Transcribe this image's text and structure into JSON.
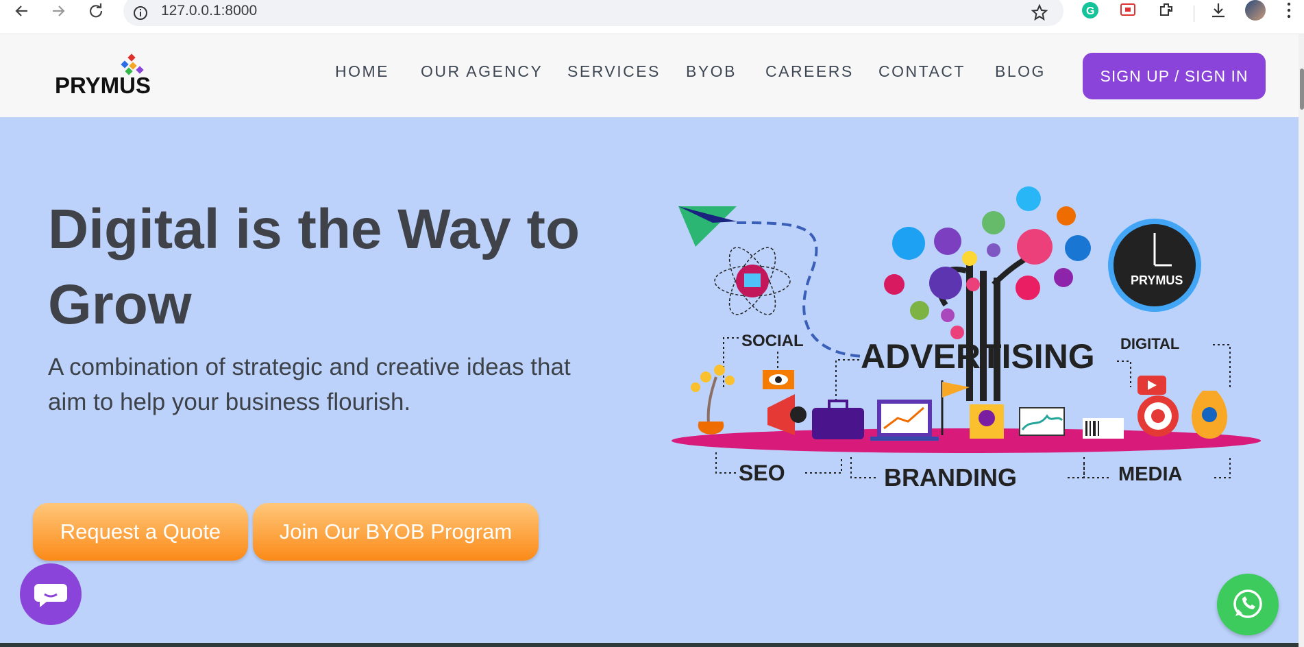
{
  "browser": {
    "url": "127.0.0.1:8000"
  },
  "header": {
    "logo_text": "PRYMUS",
    "nav": [
      "HOME",
      "OUR AGENCY",
      "SERVICES",
      "BYOB",
      "CAREERS",
      "CONTACT",
      "BLOG"
    ],
    "cta": "SIGN UP / SIGN IN"
  },
  "hero": {
    "title": "Digital is the Way to Grow",
    "subtitle": "A combination of strategic and creative ideas that aim to help your business flourish.",
    "buttons": [
      "Request a Quote",
      "Join Our BYOB Program"
    ]
  },
  "illustration": {
    "labels": [
      "SOCIAL",
      "ADVERTISING",
      "DIGITAL",
      "SEO",
      "BRANDING",
      "MEDIA"
    ],
    "clock_logo": "PRYMUS"
  },
  "colors": {
    "accent_purple": "#8a44d9",
    "hero_bg": "#bcd2fb",
    "cta_orange": "#fb8a18",
    "whatsapp_green": "#3ccb5c"
  },
  "icons": [
    "back-arrow-icon",
    "forward-arrow-icon",
    "reload-icon",
    "site-info-icon",
    "bookmark-star-icon",
    "grammarly-icon",
    "screencast-icon",
    "extensions-icon",
    "download-icon",
    "profile-avatar",
    "more-menu-icon",
    "chat-bubble-icon",
    "whatsapp-icon"
  ]
}
